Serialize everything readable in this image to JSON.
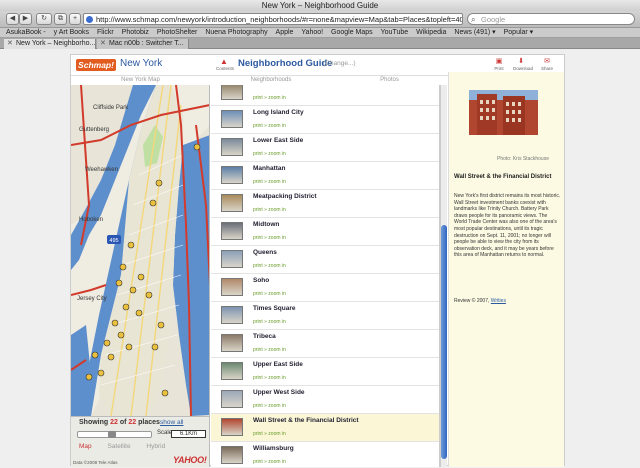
{
  "window": {
    "title": "New York – Neighborhood Guide"
  },
  "toolbar": {
    "back_label": "◀",
    "forward_label": "▶",
    "reload_label": "↻",
    "tabview_label": "⧉",
    "add_label": "+",
    "url": "http://www.schmap.com/newyork/introduction_neighborhoods/#r=none&mapview=Map&tab=Places&topleft=40.84875,-7",
    "search_placeholder": "Google"
  },
  "bookmarks": [
    "AsukaBook -",
    "y Art Books",
    "Flickr",
    "Photobiz",
    "PhotoShelter",
    "Nuena Photography",
    "Apple",
    "Yahoo!",
    "Google Maps",
    "YouTube",
    "Wikipedia",
    "News (491) ▾",
    "Popular ▾"
  ],
  "tabs": [
    {
      "label": "New York – Neighborho...",
      "active": true
    },
    {
      "label": "Mac n00b : Switcher T...",
      "active": false
    }
  ],
  "app": {
    "logo": "Schmap!",
    "city": "New York",
    "contents_label": "Contents",
    "guide_title": "Neighborhood Guide",
    "change_label": "(Change...)",
    "print_label": "Print",
    "download_label": "Download",
    "share_label": "Share",
    "subtabs": [
      "New York Map",
      "Neighborhoods",
      "Photos"
    ]
  },
  "map": {
    "showing_prefix": "Showing ",
    "showing_count": "22",
    "showing_of": " of ",
    "showing_total": "22",
    "showing_suffix": " places",
    "show_all": "show all",
    "zoom_level": 0.45,
    "scale_label": "Scale:",
    "scale_value": "6.1Km",
    "map_types": [
      "Map",
      "Satellite",
      "Hybrid"
    ],
    "active_map_type": "Map",
    "labels": [
      "Cliffside Park",
      "Guttenberg",
      "Weehawken",
      "Hoboken",
      "Jersey City"
    ],
    "copyright": "Data ©2008 Tele Atlas",
    "provider": "YAHOO!",
    "highway_shield": "495"
  },
  "neighborhoods": [
    {
      "name": "",
      "selected": false
    },
    {
      "name": "Long Island City",
      "selected": false
    },
    {
      "name": "Lower East Side",
      "selected": false
    },
    {
      "name": "Manhattan",
      "selected": false
    },
    {
      "name": "Meatpacking District",
      "selected": false
    },
    {
      "name": "Midtown",
      "selected": false
    },
    {
      "name": "Queens",
      "selected": false
    },
    {
      "name": "Soho",
      "selected": false
    },
    {
      "name": "Times Square",
      "selected": false
    },
    {
      "name": "Tribeca",
      "selected": false
    },
    {
      "name": "Upper East Side",
      "selected": false
    },
    {
      "name": "Upper West Side",
      "selected": false
    },
    {
      "name": "Wall Street & the Financial District",
      "selected": true
    },
    {
      "name": "Williamsburg",
      "selected": false
    }
  ],
  "row_actions": "print » zoom in",
  "detail": {
    "photo_credit": "Photo: Kris Stackhouse",
    "title": "Wall Street & the Financial District",
    "body": "New York's first district remains its most historic. Wall Street investment banks coexist with landmarks like Trinity Church. Battery Park draws people for its panoramic views. The World Trade Center was also one of the area's most popular destinations, until its tragic destruction on Sept. 11, 2001; no longer will people be able to view the city from its observation deck, and it may be years before this area of Manhattan returns to normal.",
    "review_prefix": "Review © 2007,",
    "review_link": "Writies"
  },
  "colors": {
    "accent": "#2c5aa0",
    "brand": "#e25b1f",
    "action_green": "#6a9c2c",
    "selected_row": "#fbf6d6"
  }
}
